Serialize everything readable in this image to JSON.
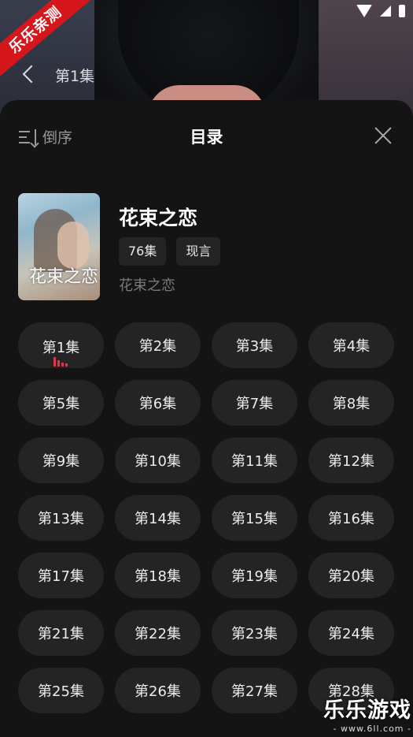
{
  "ribbon": {
    "label": "乐乐亲测"
  },
  "top_bar": {
    "episode_title": "第1集"
  },
  "panel": {
    "sort_label": "倒序",
    "title": "目录"
  },
  "show": {
    "poster_text": "花束之恋",
    "title": "花束之恋",
    "episodes_tag": "76集",
    "genre_tag": "现言",
    "subtitle": "花束之恋"
  },
  "episodes": [
    "第1集",
    "第2集",
    "第3集",
    "第4集",
    "第5集",
    "第6集",
    "第7集",
    "第8集",
    "第9集",
    "第10集",
    "第11集",
    "第12集",
    "第13集",
    "第14集",
    "第15集",
    "第16集",
    "第17集",
    "第18集",
    "第19集",
    "第20集",
    "第21集",
    "第22集",
    "第23集",
    "第24集",
    "第25集",
    "第26集",
    "第27集",
    "第28集"
  ],
  "current_episode_index": 0,
  "watermark": {
    "main": "乐乐游戏",
    "sub": "- www.6ll.com -"
  },
  "colors": {
    "accent": "#e0364b",
    "ribbon": "#d5171c"
  }
}
